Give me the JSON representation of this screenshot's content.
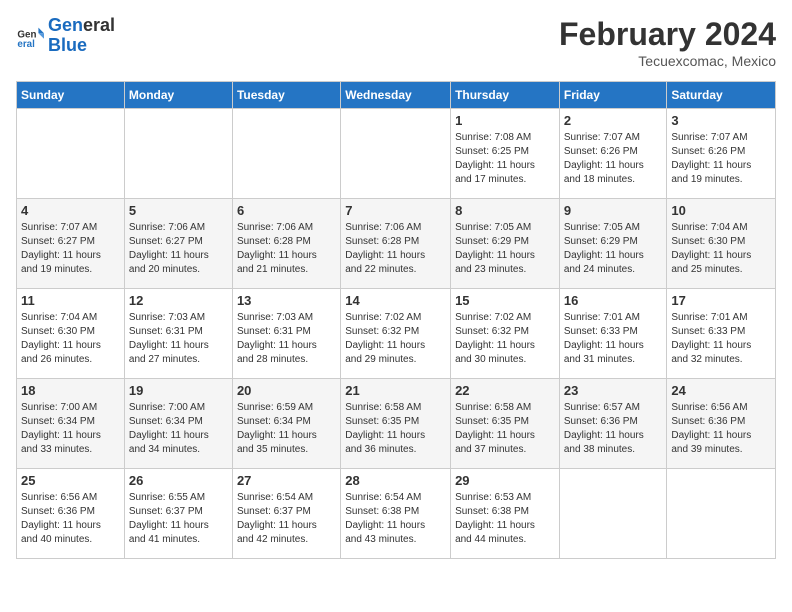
{
  "logo": {
    "line1": "General",
    "line2": "Blue"
  },
  "title": "February 2024",
  "location": "Tecuexcomac, Mexico",
  "headers": [
    "Sunday",
    "Monday",
    "Tuesday",
    "Wednesday",
    "Thursday",
    "Friday",
    "Saturday"
  ],
  "weeks": [
    [
      {
        "day": "",
        "info": ""
      },
      {
        "day": "",
        "info": ""
      },
      {
        "day": "",
        "info": ""
      },
      {
        "day": "",
        "info": ""
      },
      {
        "day": "1",
        "info": "Sunrise: 7:08 AM\nSunset: 6:25 PM\nDaylight: 11 hours\nand 17 minutes."
      },
      {
        "day": "2",
        "info": "Sunrise: 7:07 AM\nSunset: 6:26 PM\nDaylight: 11 hours\nand 18 minutes."
      },
      {
        "day": "3",
        "info": "Sunrise: 7:07 AM\nSunset: 6:26 PM\nDaylight: 11 hours\nand 19 minutes."
      }
    ],
    [
      {
        "day": "4",
        "info": "Sunrise: 7:07 AM\nSunset: 6:27 PM\nDaylight: 11 hours\nand 19 minutes."
      },
      {
        "day": "5",
        "info": "Sunrise: 7:06 AM\nSunset: 6:27 PM\nDaylight: 11 hours\nand 20 minutes."
      },
      {
        "day": "6",
        "info": "Sunrise: 7:06 AM\nSunset: 6:28 PM\nDaylight: 11 hours\nand 21 minutes."
      },
      {
        "day": "7",
        "info": "Sunrise: 7:06 AM\nSunset: 6:28 PM\nDaylight: 11 hours\nand 22 minutes."
      },
      {
        "day": "8",
        "info": "Sunrise: 7:05 AM\nSunset: 6:29 PM\nDaylight: 11 hours\nand 23 minutes."
      },
      {
        "day": "9",
        "info": "Sunrise: 7:05 AM\nSunset: 6:29 PM\nDaylight: 11 hours\nand 24 minutes."
      },
      {
        "day": "10",
        "info": "Sunrise: 7:04 AM\nSunset: 6:30 PM\nDaylight: 11 hours\nand 25 minutes."
      }
    ],
    [
      {
        "day": "11",
        "info": "Sunrise: 7:04 AM\nSunset: 6:30 PM\nDaylight: 11 hours\nand 26 minutes."
      },
      {
        "day": "12",
        "info": "Sunrise: 7:03 AM\nSunset: 6:31 PM\nDaylight: 11 hours\nand 27 minutes."
      },
      {
        "day": "13",
        "info": "Sunrise: 7:03 AM\nSunset: 6:31 PM\nDaylight: 11 hours\nand 28 minutes."
      },
      {
        "day": "14",
        "info": "Sunrise: 7:02 AM\nSunset: 6:32 PM\nDaylight: 11 hours\nand 29 minutes."
      },
      {
        "day": "15",
        "info": "Sunrise: 7:02 AM\nSunset: 6:32 PM\nDaylight: 11 hours\nand 30 minutes."
      },
      {
        "day": "16",
        "info": "Sunrise: 7:01 AM\nSunset: 6:33 PM\nDaylight: 11 hours\nand 31 minutes."
      },
      {
        "day": "17",
        "info": "Sunrise: 7:01 AM\nSunset: 6:33 PM\nDaylight: 11 hours\nand 32 minutes."
      }
    ],
    [
      {
        "day": "18",
        "info": "Sunrise: 7:00 AM\nSunset: 6:34 PM\nDaylight: 11 hours\nand 33 minutes."
      },
      {
        "day": "19",
        "info": "Sunrise: 7:00 AM\nSunset: 6:34 PM\nDaylight: 11 hours\nand 34 minutes."
      },
      {
        "day": "20",
        "info": "Sunrise: 6:59 AM\nSunset: 6:34 PM\nDaylight: 11 hours\nand 35 minutes."
      },
      {
        "day": "21",
        "info": "Sunrise: 6:58 AM\nSunset: 6:35 PM\nDaylight: 11 hours\nand 36 minutes."
      },
      {
        "day": "22",
        "info": "Sunrise: 6:58 AM\nSunset: 6:35 PM\nDaylight: 11 hours\nand 37 minutes."
      },
      {
        "day": "23",
        "info": "Sunrise: 6:57 AM\nSunset: 6:36 PM\nDaylight: 11 hours\nand 38 minutes."
      },
      {
        "day": "24",
        "info": "Sunrise: 6:56 AM\nSunset: 6:36 PM\nDaylight: 11 hours\nand 39 minutes."
      }
    ],
    [
      {
        "day": "25",
        "info": "Sunrise: 6:56 AM\nSunset: 6:36 PM\nDaylight: 11 hours\nand 40 minutes."
      },
      {
        "day": "26",
        "info": "Sunrise: 6:55 AM\nSunset: 6:37 PM\nDaylight: 11 hours\nand 41 minutes."
      },
      {
        "day": "27",
        "info": "Sunrise: 6:54 AM\nSunset: 6:37 PM\nDaylight: 11 hours\nand 42 minutes."
      },
      {
        "day": "28",
        "info": "Sunrise: 6:54 AM\nSunset: 6:38 PM\nDaylight: 11 hours\nand 43 minutes."
      },
      {
        "day": "29",
        "info": "Sunrise: 6:53 AM\nSunset: 6:38 PM\nDaylight: 11 hours\nand 44 minutes."
      },
      {
        "day": "",
        "info": ""
      },
      {
        "day": "",
        "info": ""
      }
    ]
  ]
}
